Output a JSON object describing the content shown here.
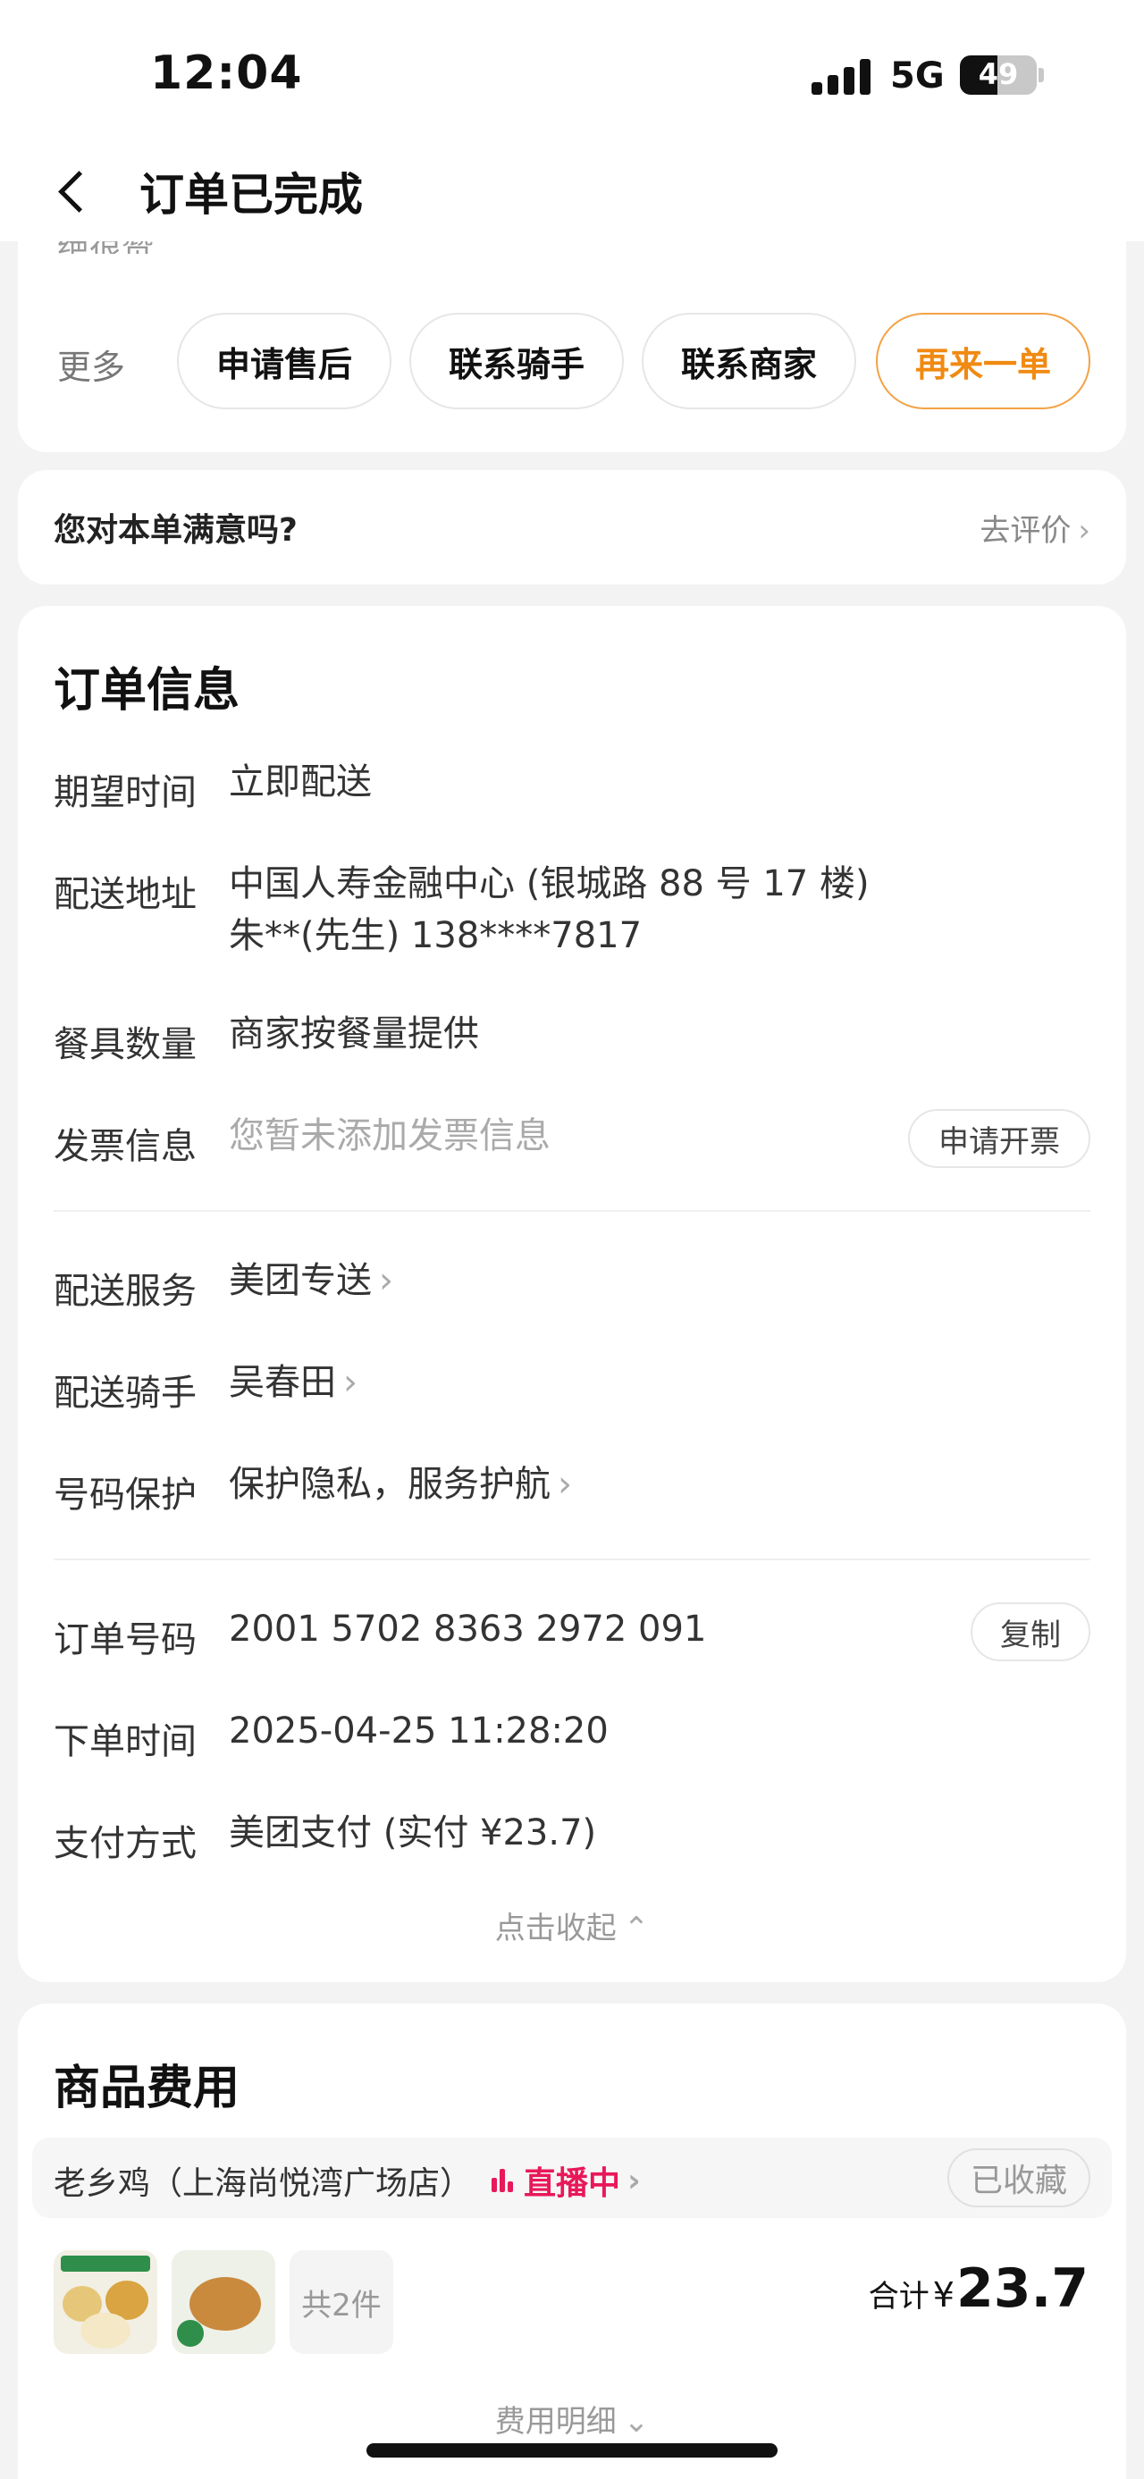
{
  "status_bar": {
    "time": "12:04",
    "network": "5G",
    "battery": "49",
    "battery_level": 0.49
  },
  "nav": {
    "title": "订单已完成"
  },
  "actions": {
    "partial_text": "绝很赞",
    "more_label": "更多",
    "buttons": [
      "申请售后",
      "联系骑手",
      "联系商家",
      "再来一单"
    ]
  },
  "rating": {
    "question": "您对本单满意吗?",
    "action": "去评价"
  },
  "order_info": {
    "title": "订单信息",
    "expected_time": {
      "label": "期望时间",
      "value": "立即配送"
    },
    "address": {
      "label": "配送地址",
      "line1": "中国人寿金融中心 (银城路 88 号 17 楼)",
      "line2": "朱**(先生) 138****7817"
    },
    "tableware": {
      "label": "餐具数量",
      "value": "商家按餐量提供"
    },
    "invoice": {
      "label": "发票信息",
      "value": "您暂未添加发票信息",
      "button": "申请开票"
    },
    "delivery_service": {
      "label": "配送服务",
      "value": "美团专送"
    },
    "rider": {
      "label": "配送骑手",
      "value": "吴春田"
    },
    "number_protect": {
      "label": "号码保护",
      "value": "保护隐私，服务护航"
    },
    "order_no": {
      "label": "订单号码",
      "value": "2001 5702 8363 2972 091",
      "button": "复制"
    },
    "order_time": {
      "label": "下单时间",
      "value": "2025-04-25 11:28:20"
    },
    "payment": {
      "label": "支付方式",
      "value": "美团支付 (实付 ¥23.7)"
    },
    "collapse": "点击收起"
  },
  "goods": {
    "title": "商品费用",
    "store": "老乡鸡（上海尚悦湾广场店）",
    "live": "直播中",
    "favorite": "已收藏",
    "count": "共2件",
    "total_label": "合计",
    "currency": "¥",
    "total": "23.7",
    "fee_detail": "费用明细"
  }
}
